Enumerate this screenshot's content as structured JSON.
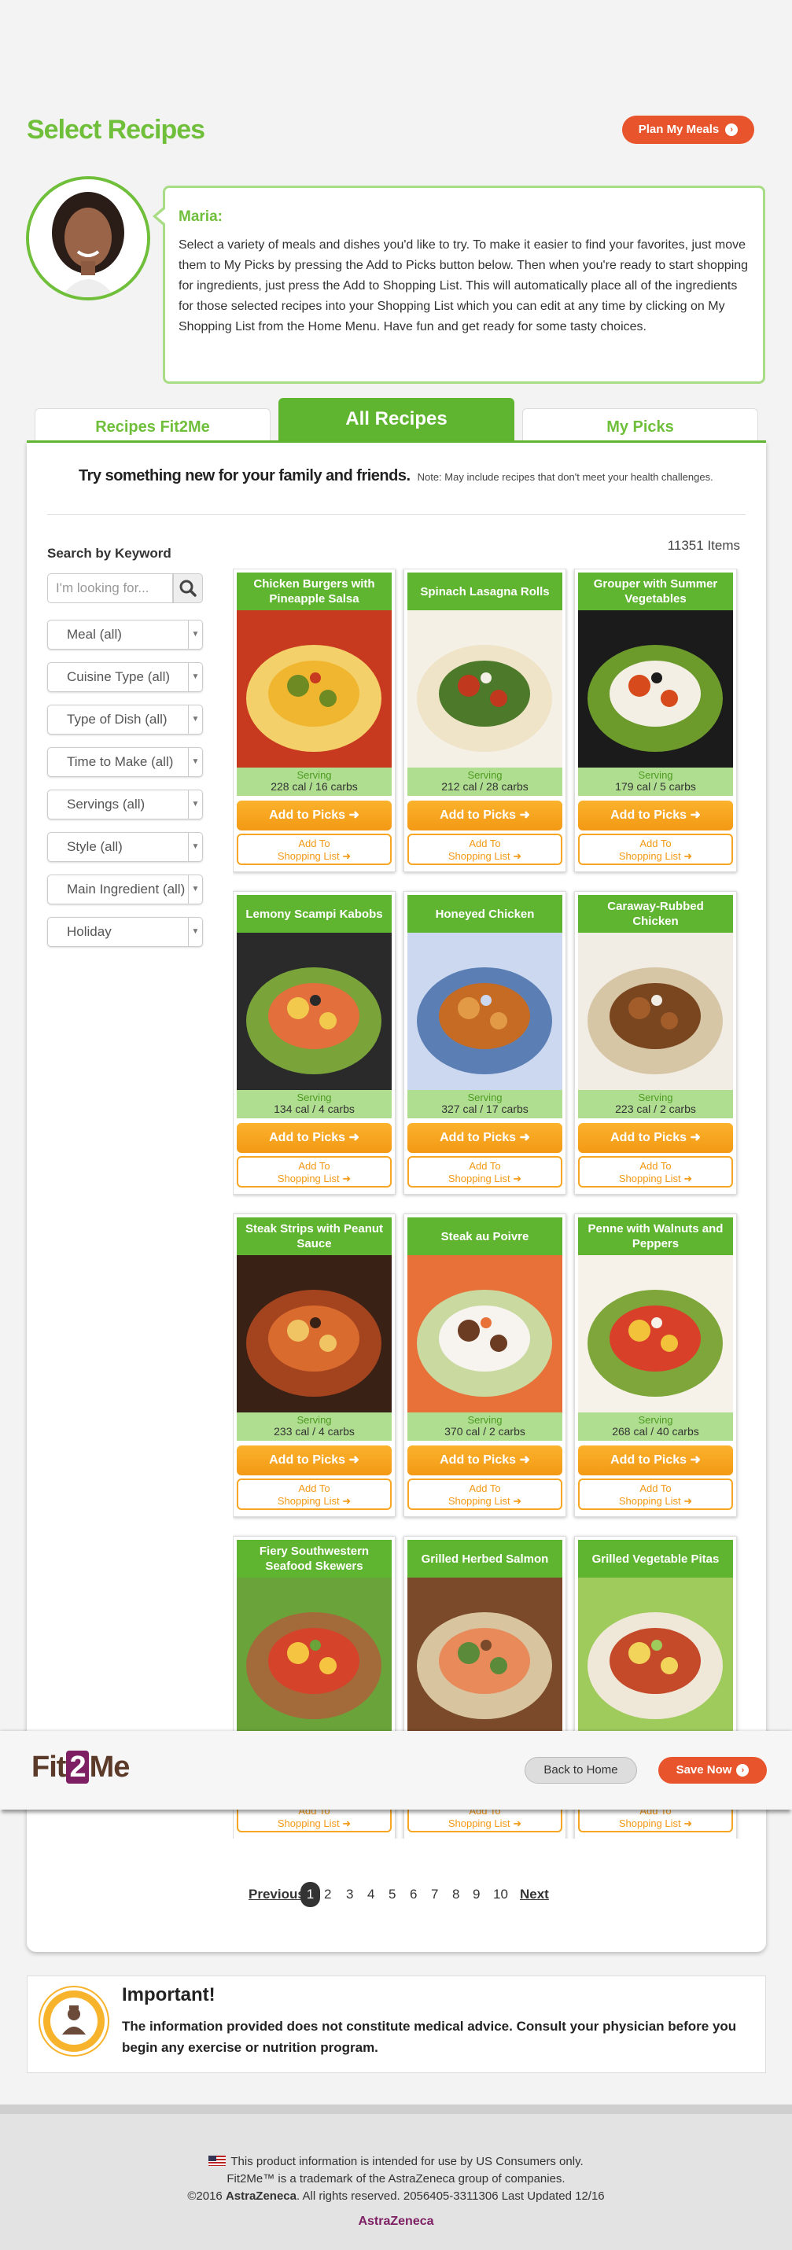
{
  "header": {
    "title": "Select Recipes",
    "plan_button": "Plan My Meals"
  },
  "intro": {
    "name": "Maria:",
    "message": "Select a variety of meals and dishes you'd like to try. To make it easier to find your favorites, just move them to My Picks by pressing the Add to Picks button below. Then when you're ready to start shopping for ingredients, just press the Add to Shopping List. This will automatically place all of the ingredients for those selected recipes into your Shopping List which you can edit at any time by clicking on My Shopping List from the Home Menu. Have fun and get ready for some tasty choices."
  },
  "tabs": [
    "Recipes Fit2Me",
    "All Recipes",
    "My Picks"
  ],
  "tagline": {
    "main": "Try something new for your family and friends.",
    "note": "Note: May include recipes that don't meet your health challenges."
  },
  "sidebar": {
    "keyword_label": "Search by Keyword",
    "keyword_placeholder": "I'm looking for...",
    "filters": [
      "Meal (all)",
      "Cuisine Type (all)",
      "Type of Dish (all)",
      "Time to Make (all)",
      "Servings (all)",
      "Style (all)",
      "Main Ingredient (all)",
      "Holiday"
    ]
  },
  "items_count": "11351 Items",
  "card_labels": {
    "serving": "Serving",
    "add_picks": "Add to Picks",
    "add_to": "Add To",
    "shopping_list": "Shopping List"
  },
  "recipes": [
    {
      "title": "Chicken Burgers with Pineapple Salsa",
      "nutrition": "228 cal / 16 carbs"
    },
    {
      "title": "Spinach Lasagna Rolls",
      "nutrition": "212 cal / 28 carbs"
    },
    {
      "title": "Grouper with Summer Vegetables",
      "nutrition": "179 cal / 5 carbs"
    },
    {
      "title": "Lemony Scampi Kabobs",
      "nutrition": "134 cal / 4 carbs"
    },
    {
      "title": "Honeyed Chicken",
      "nutrition": "327 cal / 17 carbs"
    },
    {
      "title": "Caraway-Rubbed Chicken",
      "nutrition": "223 cal / 2 carbs"
    },
    {
      "title": "Steak Strips with Peanut Sauce",
      "nutrition": "233 cal / 4 carbs"
    },
    {
      "title": "Steak au Poivre",
      "nutrition": "370 cal / 2 carbs"
    },
    {
      "title": "Penne with Walnuts and Peppers",
      "nutrition": "268 cal / 40 carbs"
    },
    {
      "title": "Fiery Southwestern Seafood Skewers",
      "nutrition": ""
    },
    {
      "title": "Grilled Herbed Salmon",
      "nutrition": ""
    },
    {
      "title": "Grilled Vegetable Pitas",
      "nutrition": ""
    }
  ],
  "pagination": {
    "previous": "Previous",
    "pages": [
      "1",
      "2",
      "3",
      "4",
      "5",
      "6",
      "7",
      "8",
      "9",
      "10"
    ],
    "current": "1",
    "next": "Next"
  },
  "important": {
    "title": "Important!",
    "text": "The information provided does not constitute medical advice. Consult your physician before you begin any exercise or nutrition program."
  },
  "footer": {
    "line1": "This product information is intended for use by US Consumers only.",
    "line2": "Fit2Me™ is a trademark of the AstraZeneca group of companies.",
    "line3_prefix": "©2016 ",
    "line3_brand": "AstraZeneca",
    "line3_suffix": ". All rights reserved. 2056405-3311306 Last Updated 12/16",
    "logo": "AstraZeneca"
  },
  "sticky": {
    "logo_left": "Fit",
    "logo_mid": "2",
    "logo_right": "Me",
    "back_button": "Back to Home",
    "save_button": "Save Now"
  },
  "colors": {
    "green": "#5fb52f",
    "orange": "#f39915",
    "red_orange": "#e8542b",
    "plum": "#7d1f62"
  }
}
